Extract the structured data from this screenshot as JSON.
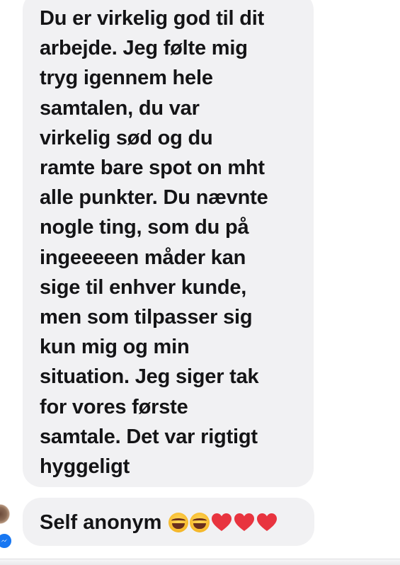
{
  "conversation": {
    "message_main_lines": [
      "Du er virkelig god til dit",
      "arbejde. Jeg følte mig",
      "tryg igennem hele",
      "samtalen, du var",
      "virkelig sød og du",
      "ramte bare spot on mht",
      "alle punkter. Du nævnte",
      "nogle ting, som du på",
      "ingeeeeen måder kan",
      "sige til enhver kunde,",
      "men som tilpasser sig",
      "kun mig og min",
      "situation. Jeg siger tak",
      "for vores første",
      "samtale. Det var rigtigt",
      "hyggeligt"
    ],
    "message_last_text": "Self anonym",
    "message_last_emojis": [
      "laughing-tears",
      "laughing-tears",
      "red-heart",
      "red-heart",
      "red-heart"
    ]
  },
  "colors": {
    "bubble_background": "#f1f1f3",
    "text": "#141416",
    "messenger_badge": "#1877f2",
    "heart": "#e8343f",
    "emoji_face": "#f6b82a"
  }
}
